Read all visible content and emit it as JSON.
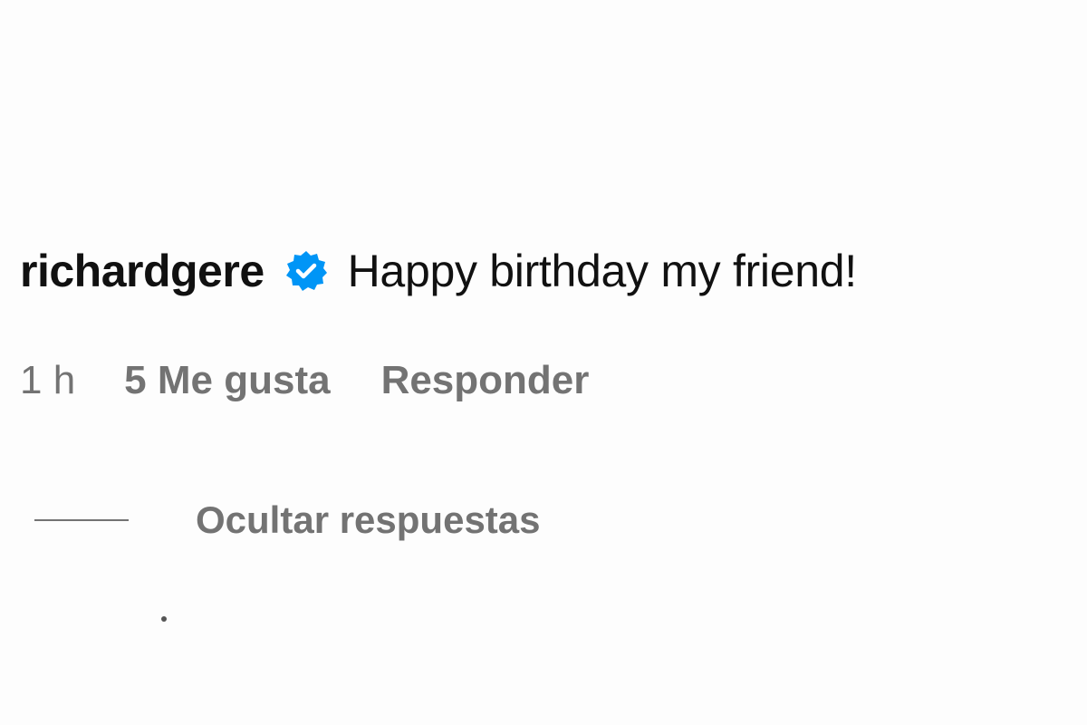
{
  "comment": {
    "username": "richardgere",
    "verified_icon": "verified-badge-icon",
    "text": "Happy birthday my friend!",
    "time": "1 h",
    "likes": "5 Me gusta",
    "reply_label": "Responder"
  },
  "replies": {
    "toggle_label": "Ocultar respuestas"
  },
  "colors": {
    "verified": "#0095f6",
    "primary_text": "#111111",
    "secondary_text": "#737373",
    "background": "#fdfdfd"
  }
}
